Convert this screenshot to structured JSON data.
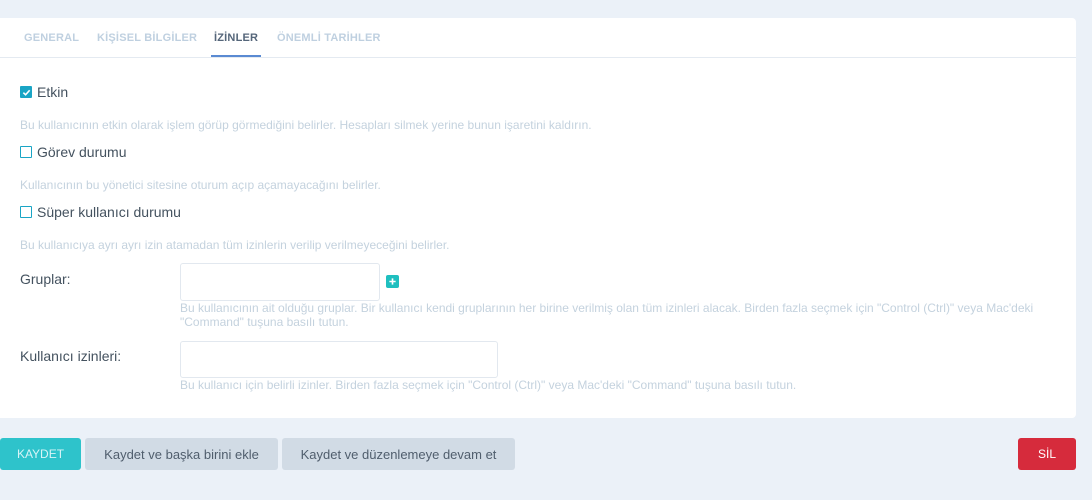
{
  "tabs": [
    {
      "label": "GENERAL"
    },
    {
      "label": "KİŞİSEL BİLGİLER"
    },
    {
      "label": "İZİNLER"
    },
    {
      "label": "ÖNEMLİ TARİHLER"
    }
  ],
  "active_tab": "İZİNLER",
  "permissions": {
    "active": {
      "label": "Etkin",
      "checked": true,
      "help": "Bu kullanıcının etkin olarak işlem görüp görmediğini belirler. Hesapları silmek yerine bunun işaretini kaldırın."
    },
    "staff": {
      "label": "Görev durumu",
      "checked": false,
      "help": "Kullanıcının bu yönetici sitesine oturum açıp açamayacağını belirler."
    },
    "superuser": {
      "label": "Süper kullanıcı durumu",
      "checked": false,
      "help": "Bu kullanıcıya ayrı ayrı izin atamadan tüm izinlerin verilip verilmeyeceğini belirler."
    }
  },
  "groups": {
    "label": "Gruplar:",
    "help": "Bu kullanıcının ait olduğu gruplar. Bir kullanıcı kendi gruplarının her birine verilmiş olan tüm izinleri alacak. Birden fazla seçmek için \"Control (Ctrl)\" veya Mac'deki \"Command\" tuşuna basılı tutun."
  },
  "user_permissions": {
    "label": "Kullanıcı izinleri:",
    "help": "Bu kullanıcı için belirli izinler. Birden fazla seçmek için \"Control (Ctrl)\" veya Mac'deki \"Command\" tuşuna basılı tutun."
  },
  "actions": {
    "save": "KAYDET",
    "save_add_another": "Kaydet ve başka birini ekle",
    "save_continue": "Kaydet ve düzenlemeye devam et",
    "delete": "SİL"
  },
  "colors": {
    "accent": "#1aa5c5",
    "save": "#24c1c9",
    "delete": "#d62b3c"
  }
}
